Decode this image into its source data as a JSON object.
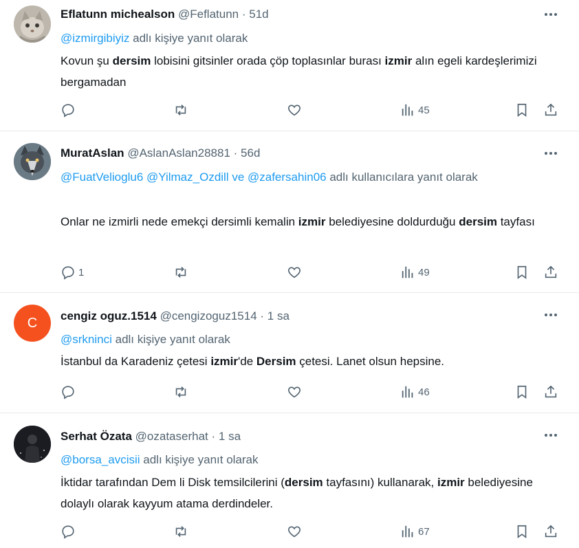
{
  "tweets": [
    {
      "name": "Eflatunn michealson",
      "handle": "@Feflatunn",
      "time": "51d",
      "reply_mentions": "@izmirgibiyiz",
      "reply_suffix": "adlı kişiye yanıt olarak",
      "text_parts": [
        "Kovun şu ",
        "dersim",
        " lobisini gitsinler orada çöp toplasınlar burası ",
        "izmir",
        " alın egeli kardeşlerimizi bergamadan"
      ],
      "replies": "",
      "views": "45",
      "avatar": "cat-avatar"
    },
    {
      "name": "MuratAslan",
      "handle": "@AslanAslan28881",
      "time": "56d",
      "reply_mentions": "@FuatVelioglu6 @Yilmaz_Ozdill ve @zafersahin06",
      "reply_suffix": "adlı kullanıcılara yanıt olarak",
      "text_parts": [
        "Onlar ne izmirli nede emekçi dersimli kemalin ",
        "izmir",
        " belediyesine doldurduğu ",
        "dersim",
        " tayfası"
      ],
      "replies": "1",
      "views": "49",
      "avatar": "wolf-avatar"
    },
    {
      "name": "cengiz oguz.1514",
      "handle": "@cengizoguz1514",
      "time": "1 sa",
      "reply_mentions": "@srkninci",
      "reply_suffix": "adlı kişiye yanıt olarak",
      "text_parts": [
        "İstanbul da Karadeniz çetesi ",
        "izmir",
        "'de ",
        "Dersim",
        " çetesi. Lanet olsun hepsine."
      ],
      "replies": "",
      "views": "46",
      "avatar_letter": "C",
      "avatar_color": "#f4511e"
    },
    {
      "name": "Serhat Özata",
      "handle": "@ozataserhat",
      "time": "1 sa",
      "reply_mentions": "@borsa_avcisii",
      "reply_suffix": "adlı kişiye yanıt olarak",
      "text_parts": [
        "İktidar tarafından Dem li Disk temsilcilerini (",
        "dersim",
        " tayfasını) kullanarak, ",
        "izmir",
        " belediyesine dolaylı olarak kayyum atama derdindeler."
      ],
      "replies": "",
      "views": "67",
      "avatar": "person-avatar"
    }
  ],
  "colors": {
    "link": "#1d9bf0",
    "muted": "#536471",
    "text": "#0f1419"
  }
}
